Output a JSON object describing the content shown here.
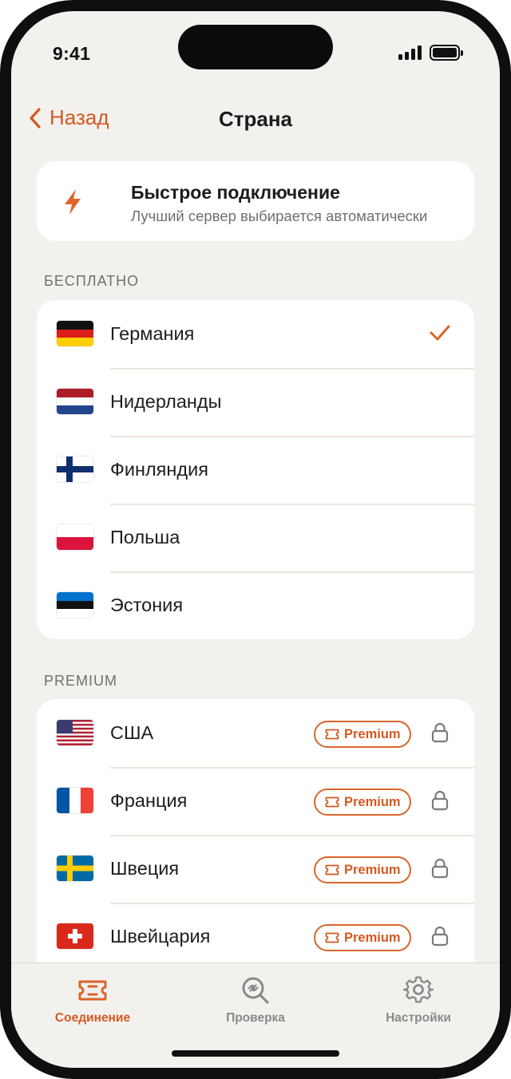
{
  "status_bar": {
    "time": "9:41",
    "signal_icon": "cellular-signal-icon",
    "battery_icon": "battery-full-icon"
  },
  "nav": {
    "back_label": "Назад",
    "back_icon": "chevron-left-icon",
    "title": "Страна"
  },
  "quick_connect": {
    "icon": "lightning-bolt-icon",
    "title": "Быстрое подключение",
    "subtitle": "Лучший сервер выбирается автоматически"
  },
  "free_section": {
    "label": "БЕСПЛАТНО",
    "items": [
      {
        "name": "Германия",
        "flag": "flag-germany-icon",
        "selected": true
      },
      {
        "name": "Нидерланды",
        "flag": "flag-netherlands-icon",
        "selected": false
      },
      {
        "name": "Финляндия",
        "flag": "flag-finland-icon",
        "selected": false
      },
      {
        "name": "Польша",
        "flag": "flag-poland-icon",
        "selected": false
      },
      {
        "name": "Эстония",
        "flag": "flag-estonia-icon",
        "selected": false
      }
    ]
  },
  "premium_section": {
    "label": "PREMIUM",
    "badge_label": "Premium",
    "items": [
      {
        "name": "США",
        "flag": "flag-usa-icon",
        "locked": true
      },
      {
        "name": "Франция",
        "flag": "flag-france-icon",
        "locked": true
      },
      {
        "name": "Швеция",
        "flag": "flag-sweden-icon",
        "locked": true
      },
      {
        "name": "Швейцария",
        "flag": "flag-switzerland-icon",
        "locked": true
      }
    ]
  },
  "tab_bar": {
    "tabs": [
      {
        "label": "Соединение",
        "icon": "ticket-icon",
        "active": true
      },
      {
        "label": "Проверка",
        "icon": "magnifier-link-icon",
        "active": false
      },
      {
        "label": "Настройки",
        "icon": "gear-icon",
        "active": false
      }
    ]
  },
  "colors": {
    "accent": "#d35a22",
    "background": "#f3f1ed",
    "card": "#ffffff",
    "muted_text": "#707070"
  }
}
